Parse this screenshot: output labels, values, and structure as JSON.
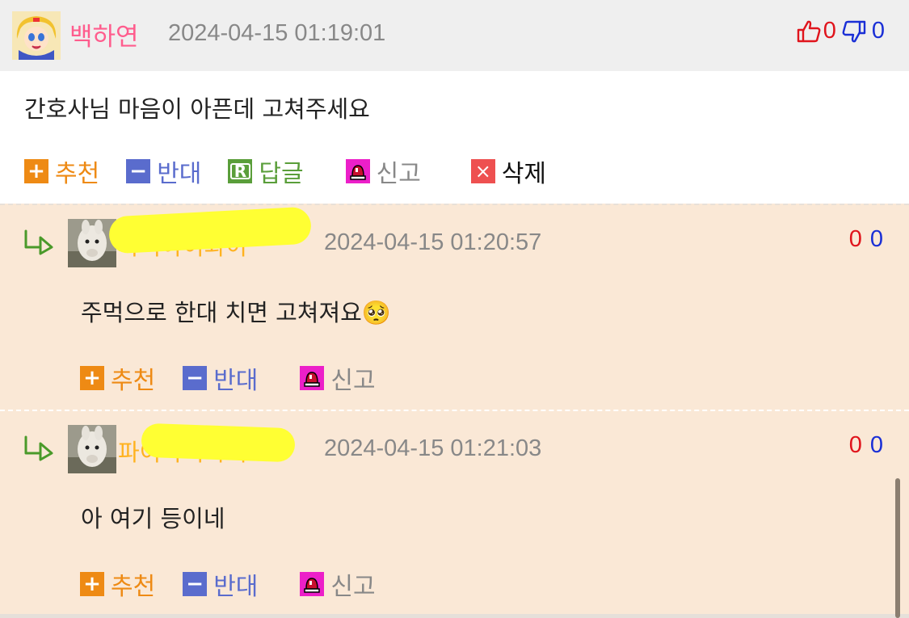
{
  "main_comment": {
    "nickname": "백하연",
    "date": "2024-04-15 01:19:01",
    "upvotes": "0",
    "downvotes": "0",
    "content": "간호사님 마음이 아픈데 고쳐주세요"
  },
  "actions": {
    "recommend": "추천",
    "oppose": "반대",
    "reply": "답글",
    "report": "신고",
    "delete": "삭제"
  },
  "replies": [
    {
      "nickname": "파이아이와이",
      "date": "2024-04-15 01:20:57",
      "upvotes": "0",
      "downvotes": "0",
      "content": "주먹으로 한대 치면 고쳐져요🥺"
    },
    {
      "nickname": "파이아이와이",
      "date": "2024-04-15 01:21:03",
      "upvotes": "0",
      "downvotes": "0",
      "content": "아 여기 등이네"
    }
  ],
  "colors": {
    "nickname_main": "#ff5c8d",
    "nickname_reply": "#ffb21f",
    "upvote": "#e0141c",
    "downvote": "#1a2fd6",
    "reply_background": "#fae8d6",
    "header_background": "#efefef"
  },
  "icons": [
    "thumbs-up-icon",
    "thumbs-down-icon",
    "plus-icon",
    "minus-icon",
    "reply-icon",
    "siren-icon",
    "delete-icon",
    "reply-arrow-icon"
  ]
}
